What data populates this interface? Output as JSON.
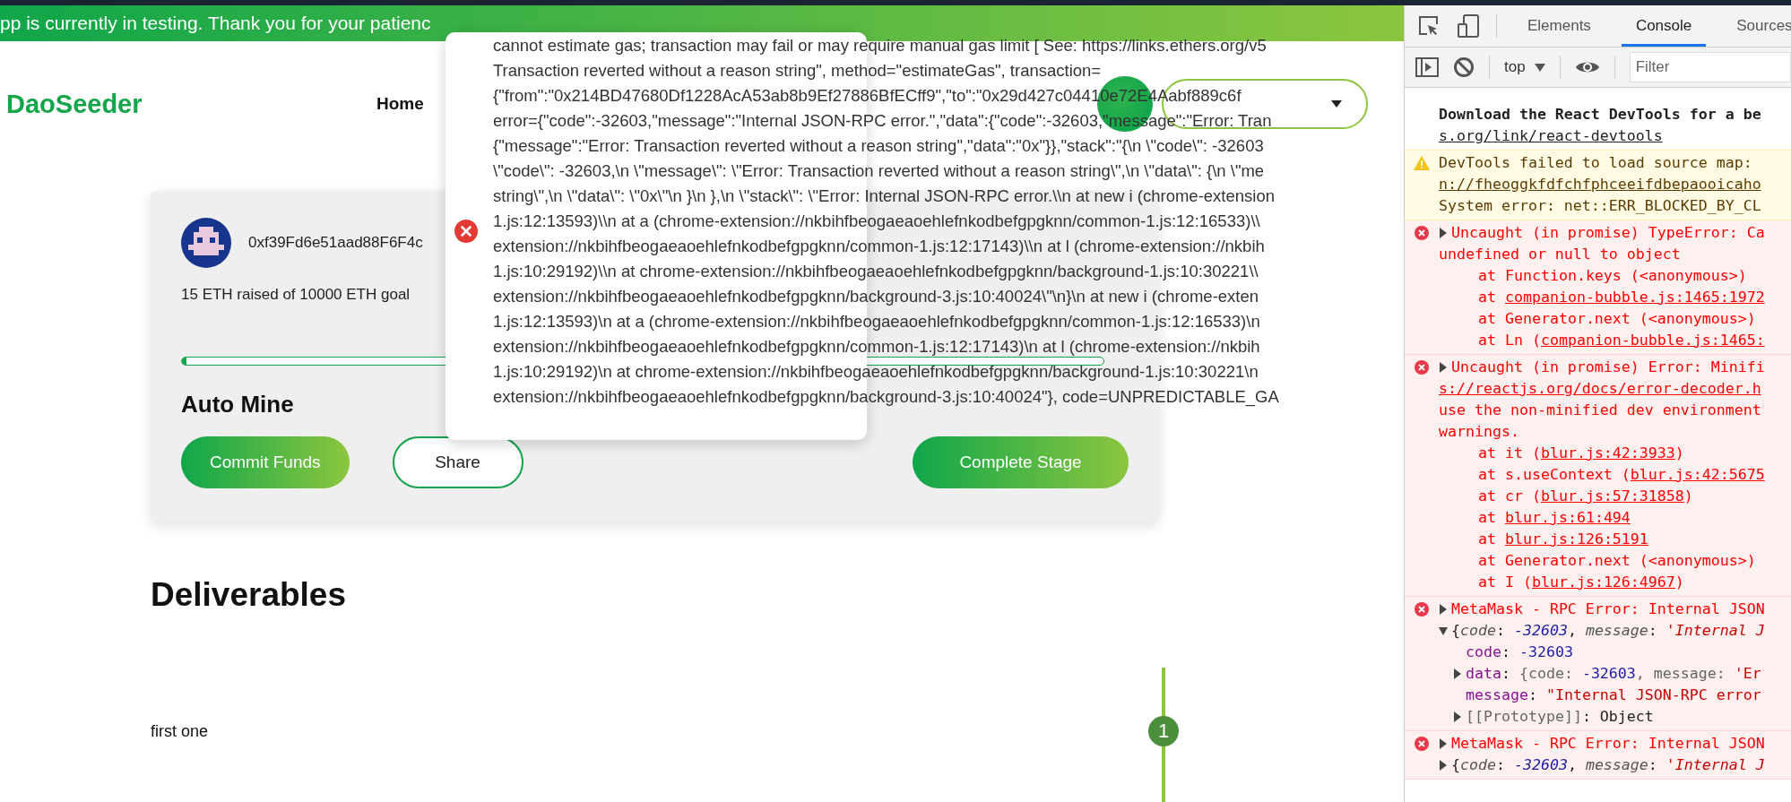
{
  "banner": {
    "text": "pp is currently in testing. Thank you for your patienc"
  },
  "header": {
    "logo": "DaoSeeder",
    "nav": [
      "Home"
    ]
  },
  "project": {
    "address": "0xf39Fd6e51aad88F6F4c",
    "raised": "15 ETH raised of 10000 ETH goal",
    "progress": {
      "level": 0.005
    },
    "title": "Auto Mine",
    "buttons": [
      {
        "label": "Commit Funds",
        "kind": "primary"
      },
      {
        "label": "Share",
        "kind": "outline"
      }
    ],
    "stage_button": {
      "label": "Complete Stage",
      "kind": "primary"
    }
  },
  "deliverables": {
    "title": "Deliverables",
    "items": [
      {
        "name": "first one",
        "number": "1"
      }
    ]
  },
  "toast": {
    "kind": "error",
    "lines": [
      "cannot estimate gas; transaction may fail or may require manual gas limit [ See: https://links.ethers.org/v5",
      "Transaction reverted without a reason string\", method=\"estimateGas\", transaction=",
      "{\"from\":\"0x214BD47680Df1228AcA53ab8b9Ef27886BfECff9\",\"to\":\"0x29d427c04410e72E4Aabf889c6f",
      "error={\"code\":-32603,\"message\":\"Internal JSON-RPC error.\",\"data\":{\"code\":-32603,\"message\":\"Error: Tran",
      "{\"message\":\"Error: Transaction reverted without a reason string\",\"data\":\"0x\"}},\"stack\":\"{\\n \\\"code\\\": -32603",
      "\\\"code\\\": -32603,\\n \\\"message\\\": \\\"Error: Transaction reverted without a reason string\\\",\\n \\\"data\\\": {\\n \\\"me",
      "string\\\",\\n \\\"data\\\": \\\"0x\\\"\\n }\\n },\\n \\\"stack\\\": \\\"Error: Internal JSON-RPC error.\\\\n at new i (chrome-extension",
      "1.js:12:13593)\\\\n at a (chrome-extension://nkbihfbeogaeaoehlefnkodbefgpgknn/common-1.js:12:16533)\\\\",
      "extension://nkbihfbeogaeaoehlefnkodbefgpgknn/common-1.js:12:17143)\\\\n at l (chrome-extension://nkbih",
      "1.js:10:29192)\\\\n at chrome-extension://nkbihfbeogaeaoehlefnkodbefgpgknn/background-1.js:10:30221\\\\",
      "extension://nkbihfbeogaeaoehlefnkodbefgpgknn/background-3.js:10:40024\\\"\\n}\\n at new i (chrome-exten",
      "1.js:12:13593)\\n at a (chrome-extension://nkbihfbeogaeaoehlefnkodbefgpgknn/common-1.js:12:16533)\\n",
      "extension://nkbihfbeogaeaoehlefnkodbefgpgknn/common-1.js:12:17143)\\n at l (chrome-extension://nkbih",
      "1.js:10:29192)\\n at chrome-extension://nkbihfbeogaeaoehlefnkodbefgpgknn/background-1.js:10:30221\\n",
      "extension://nkbihfbeogaeaoehlefnkodbefgpgknn/background-3.js:10:40024\"}, code=UNPREDICTABLE_GA"
    ]
  },
  "devtools": {
    "tabs": [
      {
        "label": "Elements",
        "selected": false
      },
      {
        "label": "Console",
        "selected": true
      },
      {
        "label": "Sources",
        "selected": false
      }
    ],
    "context": "top",
    "filter": {
      "placeholder": "Filter"
    },
    "messages": [
      {
        "kind": "info",
        "lines": [
          {
            "segs": [
              {
                "kind": "bold",
                "text": "Download the React DevTools for a be"
              }
            ]
          },
          {
            "segs": [
              {
                "kind": "link",
                "text": "s.org/link/react-devtools"
              }
            ]
          }
        ]
      },
      {
        "kind": "warning",
        "lines": [
          {
            "segs": [
              {
                "kind": "plain",
                "text": "DevTools failed to load source map:"
              }
            ]
          },
          {
            "segs": [
              {
                "kind": "link",
                "text": "n://fheoggkfdfchfphceeifdbepaooicaho"
              }
            ]
          },
          {
            "segs": [
              {
                "kind": "plain",
                "text": "System error: net::ERR_BLOCKED_BY_CL"
              }
            ]
          }
        ]
      },
      {
        "kind": "error",
        "lines": [
          {
            "expanded": false,
            "segs": [
              {
                "kind": "plain",
                "text": "Uncaught (in promise) TypeError: Ca"
              }
            ]
          },
          {
            "segs": [
              {
                "kind": "plain",
                "text": "undefined or null to object"
              }
            ]
          },
          {
            "kind": "stack",
            "segs": [
              {
                "kind": "plain",
                "text": "at Function.keys (<anonymous>)"
              }
            ]
          },
          {
            "kind": "stack",
            "segs": [
              {
                "kind": "plain",
                "text": "at "
              },
              {
                "kind": "link",
                "text": "companion-bubble.js:1465:1972"
              }
            ]
          },
          {
            "kind": "stack",
            "segs": [
              {
                "kind": "plain",
                "text": "at Generator.next (<anonymous>)"
              }
            ]
          },
          {
            "kind": "stack",
            "segs": [
              {
                "kind": "plain",
                "text": "at Ln ("
              },
              {
                "kind": "link",
                "text": "companion-bubble.js:1465:"
              }
            ]
          }
        ]
      },
      {
        "kind": "error",
        "lines": [
          {
            "expanded": false,
            "segs": [
              {
                "kind": "plain",
                "text": "Uncaught (in promise) Error: Minifi"
              }
            ]
          },
          {
            "segs": [
              {
                "kind": "link",
                "text": "s://reactjs.org/docs/error-decoder.h"
              }
            ]
          },
          {
            "segs": [
              {
                "kind": "plain",
                "text": "use the non-minified dev environment"
              }
            ]
          },
          {
            "segs": [
              {
                "kind": "plain",
                "text": "warnings."
              }
            ]
          },
          {
            "kind": "stack",
            "segs": [
              {
                "kind": "plain",
                "text": "at it ("
              },
              {
                "kind": "link",
                "text": "blur.js:42:3933"
              },
              {
                "kind": "plain",
                "text": ")"
              }
            ]
          },
          {
            "kind": "stack",
            "segs": [
              {
                "kind": "plain",
                "text": "at s.useContext ("
              },
              {
                "kind": "link",
                "text": "blur.js:42:5675"
              }
            ]
          },
          {
            "kind": "stack",
            "segs": [
              {
                "kind": "plain",
                "text": "at cr ("
              },
              {
                "kind": "link",
                "text": "blur.js:57:31858"
              },
              {
                "kind": "plain",
                "text": ")"
              }
            ]
          },
          {
            "kind": "stack",
            "segs": [
              {
                "kind": "plain",
                "text": "at "
              },
              {
                "kind": "link",
                "text": "blur.js:61:494"
              }
            ]
          },
          {
            "kind": "stack",
            "segs": [
              {
                "kind": "plain",
                "text": "at "
              },
              {
                "kind": "link",
                "text": "blur.js:126:5191"
              }
            ]
          },
          {
            "kind": "stack",
            "segs": [
              {
                "kind": "plain",
                "text": "at Generator.next (<anonymous>)"
              }
            ]
          },
          {
            "kind": "stack",
            "segs": [
              {
                "kind": "plain",
                "text": "at I ("
              },
              {
                "kind": "link",
                "text": "blur.js:126:4967"
              },
              {
                "kind": "plain",
                "text": ")"
              }
            ]
          }
        ]
      },
      {
        "kind": "error",
        "lines": [
          {
            "expanded": false,
            "segs": [
              {
                "kind": "plain",
                "text": "MetaMask - RPC Error: Internal JSON"
              }
            ]
          },
          {
            "expanded": true,
            "segs": [
              {
                "kind": "obj",
                "text": "{"
              },
              {
                "kind": "pkey",
                "text": "code"
              },
              {
                "kind": "obj",
                "text": ": "
              },
              {
                "kind": "pnum",
                "text": "-32603"
              },
              {
                "kind": "obj",
                "text": ", "
              },
              {
                "kind": "pkey",
                "text": "message"
              },
              {
                "kind": "obj",
                "text": ": "
              },
              {
                "kind": "pstr",
                "text": "'Internal J"
              }
            ],
            "children": [
              {
                "segs": [
                  {
                    "kind": "key",
                    "text": "code"
                  },
                  {
                    "kind": "obj",
                    "text": ": "
                  },
                  {
                    "kind": "num",
                    "text": "-32603"
                  }
                ]
              },
              {
                "expanded": false,
                "segs": [
                  {
                    "kind": "key",
                    "text": "data"
                  },
                  {
                    "kind": "obj",
                    "text": ": "
                  },
                  {
                    "kind": "dim",
                    "text": "{code: "
                  },
                  {
                    "kind": "num",
                    "text": "-32603"
                  },
                  {
                    "kind": "dim",
                    "text": ", message: "
                  },
                  {
                    "kind": "str",
                    "text": "'Er"
                  }
                ]
              },
              {
                "segs": [
                  {
                    "kind": "key",
                    "text": "message"
                  },
                  {
                    "kind": "obj",
                    "text": ": "
                  },
                  {
                    "kind": "str",
                    "text": "\"Internal JSON-RPC error"
                  }
                ]
              },
              {
                "expanded": false,
                "segs": [
                  {
                    "kind": "dim",
                    "text": "[[Prototype]]"
                  },
                  {
                    "kind": "obj",
                    "text": ": Object"
                  }
                ]
              }
            ]
          }
        ]
      },
      {
        "kind": "error",
        "lines": [
          {
            "expanded": false,
            "segs": [
              {
                "kind": "plain",
                "text": "MetaMask - RPC Error: Internal JSON"
              }
            ]
          },
          {
            "expanded": false,
            "segs": [
              {
                "kind": "obj",
                "text": "{"
              },
              {
                "kind": "pkey",
                "text": "code"
              },
              {
                "kind": "obj",
                "text": ": "
              },
              {
                "kind": "pnum",
                "text": "-32603"
              },
              {
                "kind": "obj",
                "text": ", "
              },
              {
                "kind": "pkey",
                "text": "message"
              },
              {
                "kind": "obj",
                "text": ": "
              },
              {
                "kind": "pstr",
                "text": "'Internal J"
              }
            ]
          }
        ]
      }
    ]
  }
}
